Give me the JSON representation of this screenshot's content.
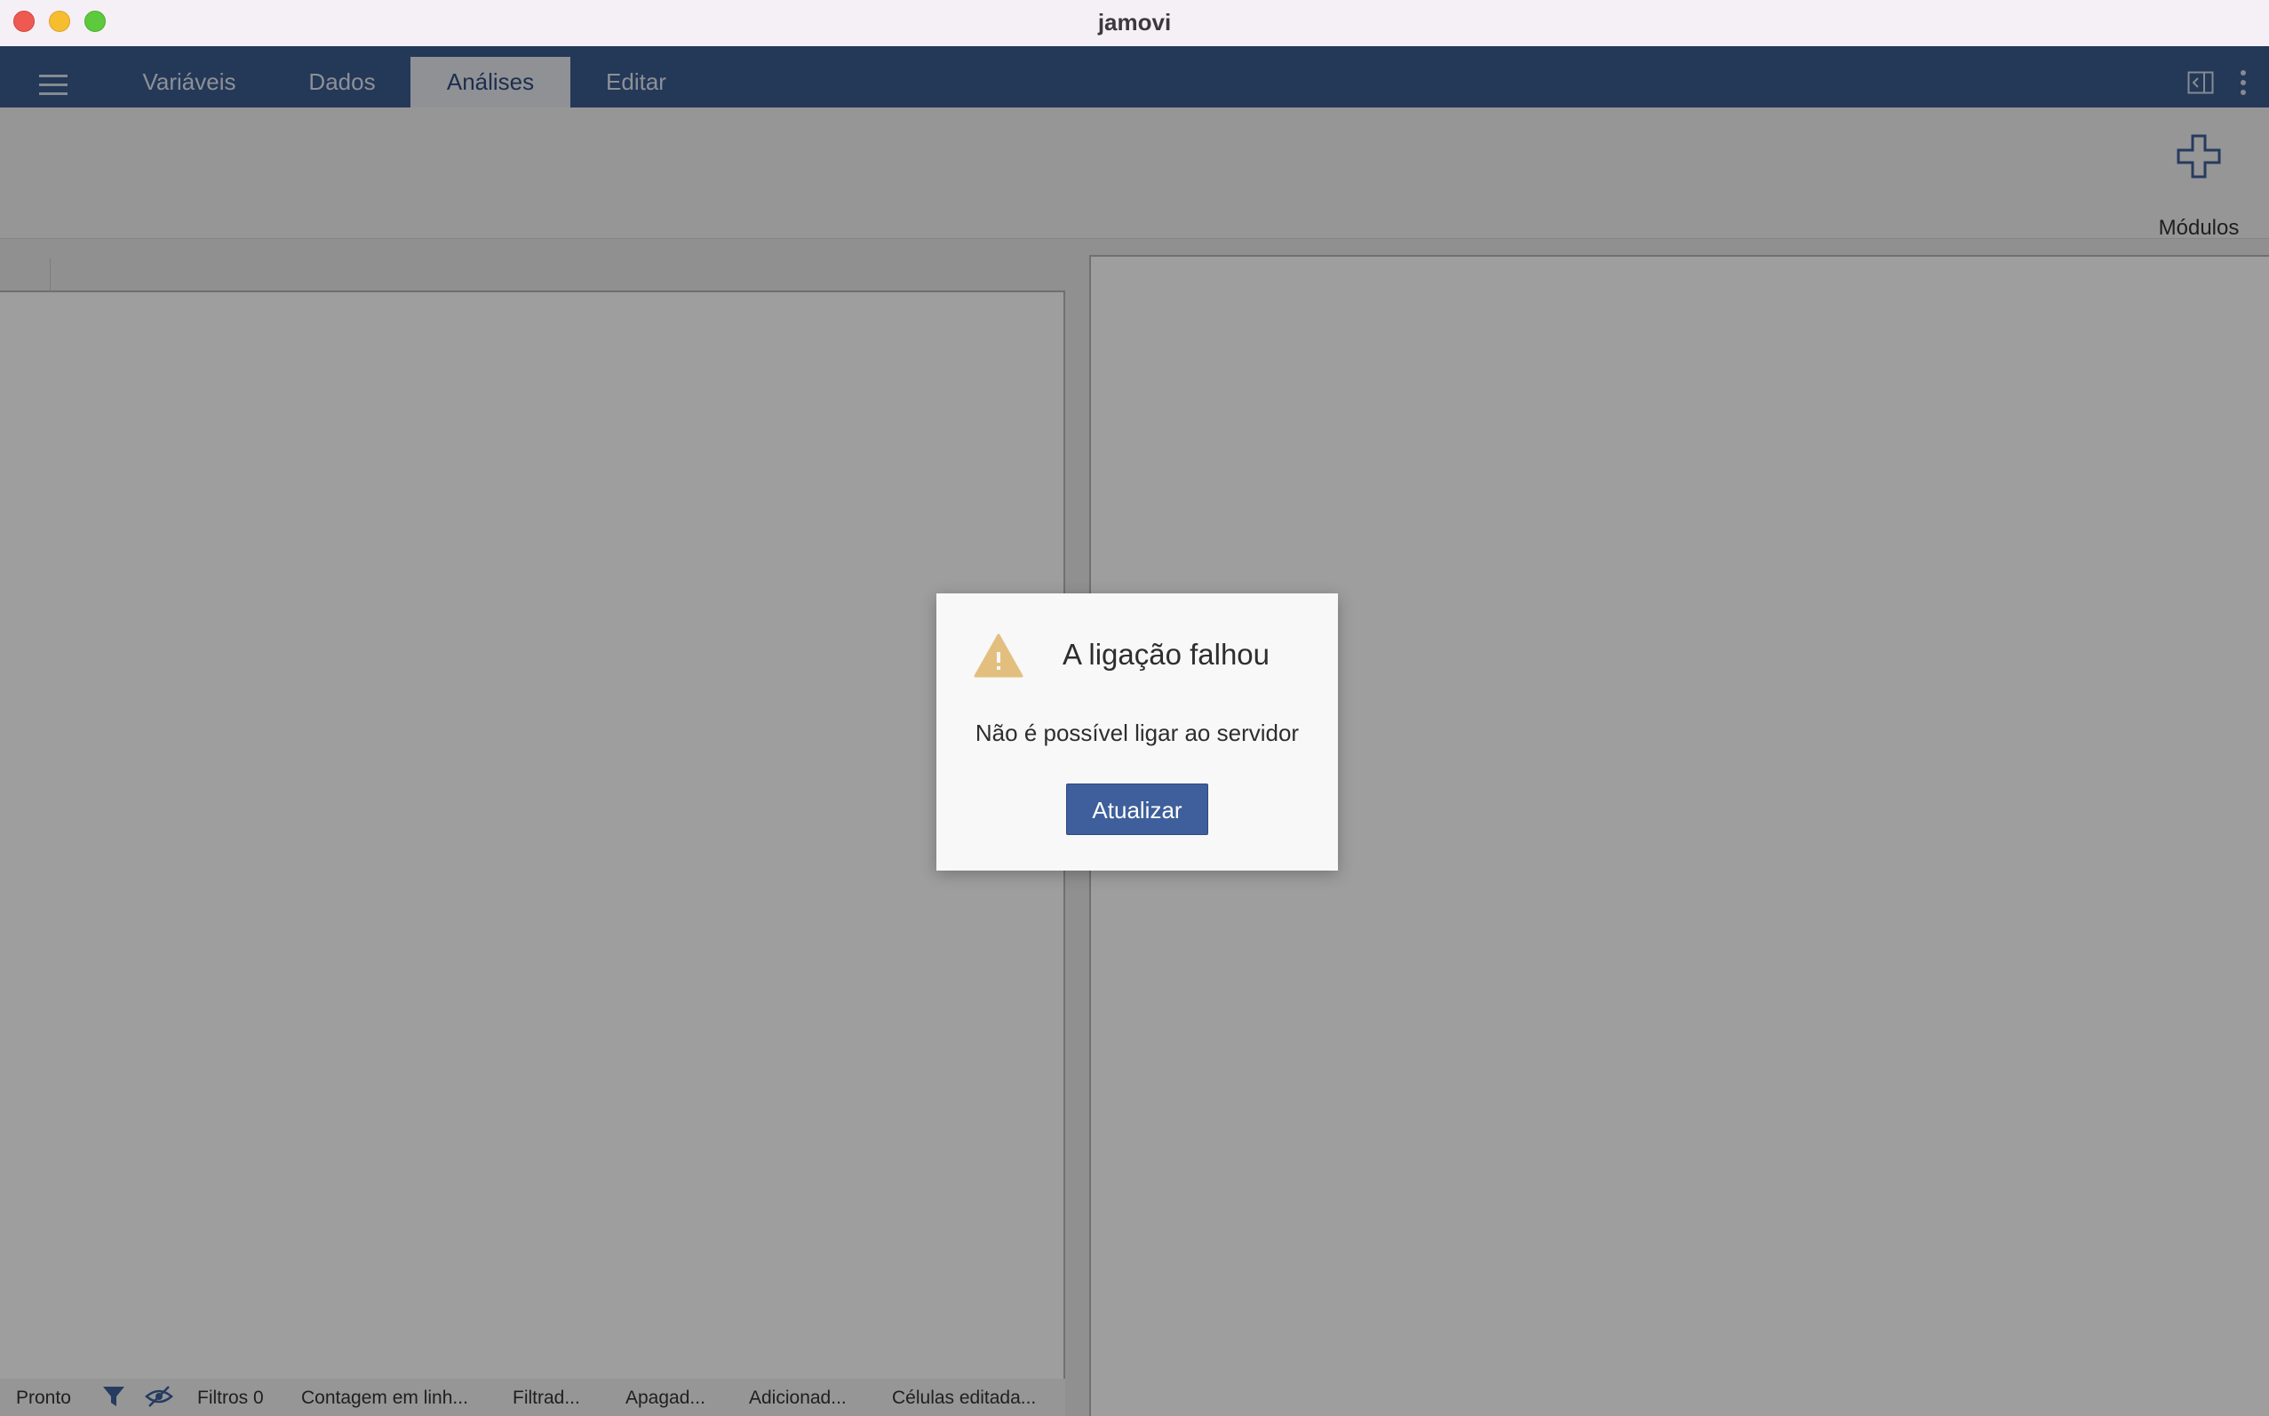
{
  "window": {
    "title": "jamovi"
  },
  "navbar": {
    "tabs": [
      {
        "label": "Variáveis",
        "active": false
      },
      {
        "label": "Dados",
        "active": false
      },
      {
        "label": "Análises",
        "active": true
      },
      {
        "label": "Editar",
        "active": false
      }
    ],
    "icons": [
      "menu-icon",
      "layout-toggle-icon",
      "more-vertical-icon"
    ]
  },
  "ribbon": {
    "modules_label": "Módulos",
    "modules_icon": "plus-icon"
  },
  "statusbar": {
    "ready": "Pronto",
    "filters": "Filtros 0",
    "row_count": "Contagem em linh...",
    "filtered": "Filtrad...",
    "deleted": "Apagad...",
    "added": "Adicionad...",
    "edited_cells": "Células editada..."
  },
  "dialog": {
    "title": "A ligação falhou",
    "message": "Não é possível ligar ao servidor",
    "button_label": "Atualizar",
    "icon": "warning-icon"
  },
  "colors": {
    "navbar": "#3b5b8f",
    "accent": "#3e5f9b",
    "warning": "#d4a84a"
  }
}
